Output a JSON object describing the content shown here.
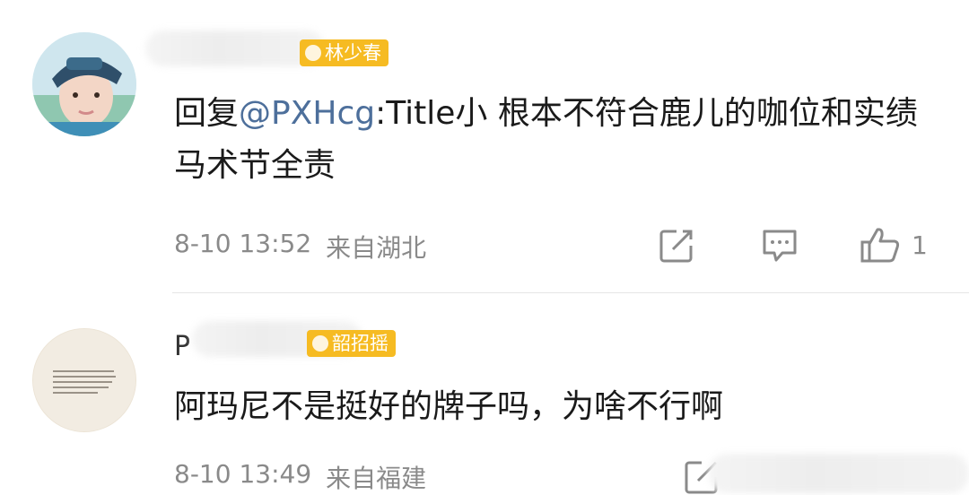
{
  "comments": [
    {
      "badge": "林少春",
      "reply_prefix": "回复",
      "mention": "@PXHcg",
      "text": ":Title小 根本不符合鹿儿的咖位和实绩 马术节全责",
      "time": "8-10 13:52",
      "location": "来自湖北",
      "likes": "1"
    },
    {
      "username_prefix": "P",
      "badge": "韶招摇",
      "text": "阿玛尼不是挺好的牌子吗，为啥不行啊",
      "time": "8-10 13:49",
      "location": "来自福建"
    }
  ],
  "icons": {
    "repost": "share-edit-icon",
    "comment": "comment-bubble-icon",
    "like": "thumbs-up-icon"
  },
  "colors": {
    "badge": "#f6bb22",
    "mention": "#4d6f9b",
    "meta": "#8a8a8a"
  }
}
